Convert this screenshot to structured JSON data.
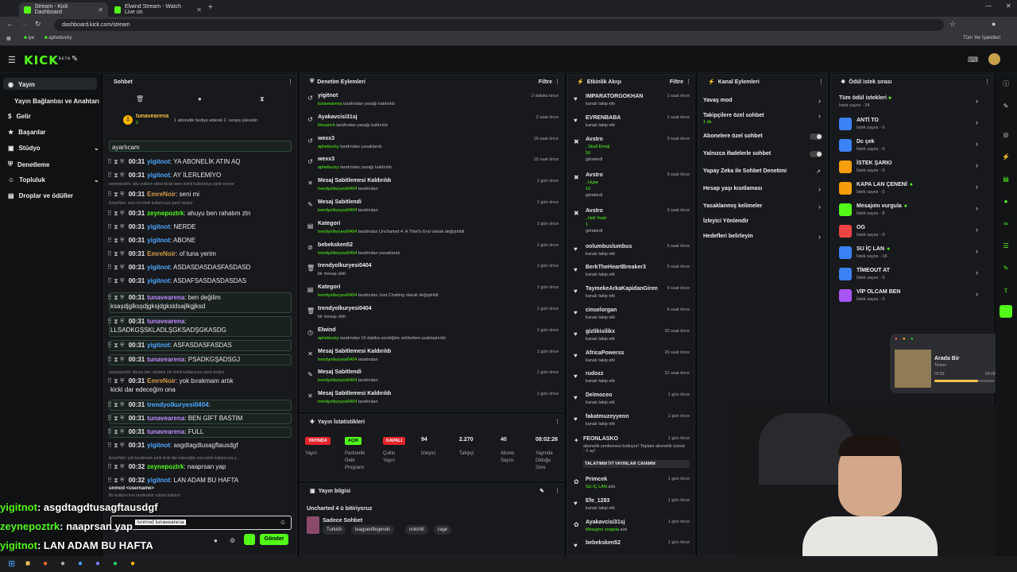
{
  "browser": {
    "tabs": [
      {
        "label": "Stream - Kick Dashboard",
        "active": true
      },
      {
        "label": "Elwind Stream - Watch Live on",
        "active": false
      }
    ],
    "url": "dashboard.kick.com/stream",
    "bookmarks": [
      "iye",
      "aphebucky"
    ],
    "all_bookmarks_label": "Tüm Yer İşaretleri"
  },
  "app": {
    "logo": "KICK",
    "logo_sup": "BETA"
  },
  "leftnav": {
    "items": [
      {
        "label": "Yayın"
      },
      {
        "label": "Yayın Bağlantısı ve Anahtarı"
      },
      {
        "label": "Gelir"
      },
      {
        "label": "Başarılar"
      },
      {
        "label": "Stüdyo"
      },
      {
        "label": "Denetleme"
      },
      {
        "label": "Topluluk"
      },
      {
        "label": "Droplar ve ödüller"
      }
    ]
  },
  "chat": {
    "title": "Sohbet",
    "pinned_user": "tunavearena",
    "pinned_count": "2",
    "pinned_text": "1 abonelik hediye ederek 2. sıraya yükselin",
    "top_fragment": "ayarlıcam",
    "messages": [
      {
        "time": "00:31",
        "user": "yigitnot",
        "color": "#4ea8ff",
        "text": ": YA ABONELİK ATIN AQ",
        "sys": ""
      },
      {
        "time": "00:31",
        "user": "yigitnot",
        "color": "#4ea8ff",
        "text": ": AY İLERLEMİYO",
        "sys": "zeynepoztrk: ahu yokken rahat birak were isimli kullaniciya yanit veriyor"
      },
      {
        "time": "00:31",
        "user": "EmreNoir",
        "color": "#d39b4a",
        "text": ": seni mi",
        "sys": "EmreNoir: seni mi isimli kullanıcıya yanıt veriyor"
      },
      {
        "time": "00:31",
        "user": "zeynepoztrk",
        "color": "#53fc18",
        "text": ": ahuyu ben rahatım ztn",
        "sys": ""
      },
      {
        "time": "00:31",
        "user": "yigitnot",
        "color": "#4ea8ff",
        "text": ": NERDE",
        "sys": ""
      },
      {
        "time": "00:31",
        "user": "yigitnot",
        "color": "#4ea8ff",
        "text": ": ABONE",
        "sys": ""
      },
      {
        "time": "00:31",
        "user": "EmreNoir",
        "color": "#d39b4a",
        "text": ": of tuna yerim",
        "sys": ""
      },
      {
        "time": "00:31",
        "user": "yigitnot",
        "color": "#4ea8ff",
        "text": ": ASDASDASDASFASDASD",
        "sys": ""
      },
      {
        "time": "00:31",
        "user": "yigitnot",
        "color": "#4ea8ff",
        "text": ": ASDAFSASDASDASDAS",
        "sys": ""
      }
    ],
    "messages2": [
      {
        "time": "00:31",
        "user": "tunavearena",
        "color": "#c28bff",
        "text": ": ben değilim",
        "line2": "ksaşdjglksşdjgksjdgksldsajlkgjksd"
      },
      {
        "time": "00:31",
        "user": "tunavearena",
        "color": "#c28bff",
        "text": ":",
        "line2": "LLSADKGŞSKLADLŞGKSADŞGKASDG"
      },
      {
        "time": "00:31",
        "user": "yigitnot",
        "color": "#4ea8ff",
        "text": ": ASFASDASFASDAS",
        "line2": ""
      },
      {
        "time": "00:31",
        "user": "tunavearena",
        "color": "#c28bff",
        "text": ": PSADKGŞADSGJ",
        "line2": ""
      }
    ],
    "sys3": "zeynepoztrk: ahuyu ben rahatım ztn isimli kullanıcıya yanıt veriyor",
    "emre_msg": {
      "time": "00:31",
      "user": "EmreNoir",
      "text": ": yok bırakmam artık",
      "line2": "kicki dar edeceğim ona"
    },
    "messages3": [
      {
        "time": "00:31",
        "user": "trendyolkuryesi0404",
        "color": "#4ea8ff",
        "text": ":"
      },
      {
        "time": "00:31",
        "user": "tunavearena",
        "color": "#c28bff",
        "text": ": BEN GİFT BASTIM"
      },
      {
        "time": "00:31",
        "user": "tunavearena",
        "color": "#c28bff",
        "text": ": FULL"
      },
      {
        "time": "00:31",
        "user": "yigitnot",
        "color": "#4ea8ff",
        "text": ": asgdtagdtusagftausdgf"
      }
    ],
    "sys4": "EmreNoir: yok bırakmam artık kicki dar edeceğim ona isimli kullanıcıya y...",
    "last_msgs": [
      {
        "time": "00:32",
        "user": "zeynepoztrk",
        "color": "#53fc18",
        "text": ": naaprsan yap"
      },
      {
        "time": "00:32",
        "user": "yigitnot",
        "color": "#4ea8ff",
        "text": ": LAN ADAM BU HAFTA"
      }
    ],
    "suggest_cmd": "unmod <username>",
    "suggest_desc": "Bir kullanıcının moderatör rolünü kaldırın",
    "input_value": "/unmod tunavearena",
    "send_label": "Gönder"
  },
  "moderation": {
    "title": "Denetim Eylemleri",
    "filter": "Filtre",
    "rows": [
      {
        "title": "yigitnot",
        "who": "tunavearena",
        "rest": " tarafından yasağı kaldırıldı",
        "time": "2 dakika önce",
        "icon": "↺"
      },
      {
        "title": "Ayakavcisi31sj",
        "who": "Revanch",
        "rest": " tarafından yasağı kaldırıldı",
        "time": "2 saat önce",
        "icon": "↺"
      },
      {
        "title": "wexx3",
        "who": "aphebucky",
        "rest": " tarafından yasaklandı",
        "time": "19 saat önce",
        "icon": "↺"
      },
      {
        "title": "wexx3",
        "who": "aphebucky",
        "rest": " tarafından yasağı kaldırıldı",
        "time": "19 saat önce",
        "icon": "↺"
      },
      {
        "title": "Mesaj Sabitlemesi Kaldırıldı",
        "who": "trendyolkuryesi0404",
        "rest": " tarafından",
        "time": "1 gün önce",
        "icon": "✕"
      },
      {
        "title": "Mesaj Sabitlendi",
        "who": "trendyolkuryesi0404",
        "rest": " tarafından",
        "time": "1 gün önce",
        "icon": "✎"
      },
      {
        "title": "Kategori",
        "who": "trendyolkuryesi0404",
        "rest": " tarafından Uncharted 4: A Thief's End olarak değiştirildi",
        "time": "1 gün önce",
        "icon": "▤"
      },
      {
        "title": "bebeksken52",
        "who": "trendyolkuryesi0404",
        "rest": " tarafından yasaklandı",
        "time": "1 gün önce",
        "icon": "⊘"
      },
      {
        "title": "trendyolkuryesi0404",
        "who": "",
        "rest": "bir mesajı sildi",
        "time": "1 gün önce",
        "icon": "🗑"
      },
      {
        "title": "Kategori",
        "who": "trendyolkuryesi0404",
        "rest": " tarafından Just Chatting olarak değiştirildi",
        "time": "1 gün önce",
        "icon": "▤"
      },
      {
        "title": "trendyolkuryesi0404",
        "who": "",
        "rest": "bir mesajı sildi",
        "time": "1 gün önce",
        "icon": "🗑"
      },
      {
        "title": "Elwind",
        "who": "aphebucky",
        "rest": " tarafından 15 dakika süreliğine sohbetten uzaklaştırıldı",
        "time": "1 gün önce",
        "icon": "◷"
      },
      {
        "title": "Mesaj Sabitlemesi Kaldırıldı",
        "who": "trendyolkuryesi0404",
        "rest": " tarafından",
        "time": "1 gün önce",
        "icon": "✕"
      },
      {
        "title": "Mesaj Sabitlendi",
        "who": "trendyolkuryesi0404",
        "rest": " tarafından",
        "time": "1 gün önce",
        "icon": "✎"
      },
      {
        "title": "Mesaj Sabitlemesi Kaldırıldı",
        "who": "trendyolkuryesi0404",
        "rest": " tarafından",
        "time": "1 gün önce",
        "icon": "✕"
      }
    ]
  },
  "stats": {
    "title": "Yayın İstatistikleri",
    "items": [
      {
        "value": "YAYINDA",
        "label": "Yayın",
        "kind": "red"
      },
      {
        "value": "AÇIK",
        "label": "Partnerlik\nGelir\nProgramı",
        "kind": "green"
      },
      {
        "value": "KAPALI",
        "label": "Çoklu\nYayın",
        "kind": "red"
      },
      {
        "value": "94",
        "label": "İzleyici",
        "kind": "num"
      },
      {
        "value": "2.270",
        "label": "Takipçi",
        "kind": "num"
      },
      {
        "value": "40",
        "label": "Abone\nSayısı",
        "kind": "num"
      },
      {
        "value": "08:02:26",
        "label": "Yayında\nOlduğu\nSüre",
        "kind": "num"
      }
    ]
  },
  "streaminfo": {
    "title": "Yayın bilgisi",
    "stream_title": "Uncharted 4 ü bitiriyoruz",
    "category": "Sadece Sohbet",
    "tags": [
      "Turkish",
      "leagueoflegends",
      "notchill",
      "rage"
    ]
  },
  "activity": {
    "title": "Etkinlik Akışı",
    "filter": "Filtre",
    "items": [
      {
        "user": "IMPARATORGOKHAN",
        "sub": "kanalı takip etti",
        "time": "1 saat önce",
        "icon": "♥"
      },
      {
        "user": "EVRENBABA",
        "sub": "kanalı takip etti",
        "time": "2 saat önce",
        "icon": "♥"
      },
      {
        "user": "Avstro",
        "sub": ", Skull Emoji",
        "sub2": "50",
        "sub3": "gönderdi",
        "time": "3 saat önce",
        "icon": "✖"
      },
      {
        "user": "Avstro",
        "sub": ", Hype",
        "sub2": "10",
        "sub3": "gönderdi",
        "time": "3 saat önce",
        "icon": "✖"
      },
      {
        "user": "Avstro",
        "sub": ", Hell Yeah",
        "sub2": "1",
        "sub3": "gönderdi",
        "time": "3 saat önce",
        "icon": "✖"
      },
      {
        "user": "oolumbuslumbus",
        "sub": "kanalı takip etti",
        "time": "5 saat önce",
        "icon": "♥"
      },
      {
        "user": "BerkTheHeartBreaker3",
        "sub": "kanalı takip etti",
        "time": "5 saat önce",
        "icon": "♥"
      },
      {
        "user": "TaymekeArkaKapidanGiren",
        "sub": "kanalı takip etti",
        "time": "6 saat önce",
        "icon": "♥"
      },
      {
        "user": "cinselorgan",
        "sub": "kanalı takip etti",
        "time": "6 saat önce",
        "icon": "♥"
      },
      {
        "user": "gizlikisilikx",
        "sub": "kanalı takip etti",
        "time": "20 saat önce",
        "icon": "♥"
      },
      {
        "user": "AfricaPowerss",
        "sub": "kanalı takip etti",
        "time": "20 saat önce",
        "icon": "♥"
      },
      {
        "user": "rudozz",
        "sub": "kanalı takip etti",
        "time": "22 saat önce",
        "icon": "♥"
      },
      {
        "user": "Delmoceo",
        "sub": "kanalı takip etti",
        "time": "1 gün önce",
        "icon": "♥"
      },
      {
        "user": "fakatmuzeyyenn",
        "sub": "kanalı takip etti",
        "time": "1 gün önce",
        "icon": "♥"
      }
    ],
    "feonlasko": {
      "user": "FEONLASKO",
      "time": "1 gün önce",
      "line": "abonelik yenilemesi kutluyor! Toplam abonelik süresi - 2 ay!",
      "msg": "TALATIMM İYİ YAYINLAR CANIMM"
    },
    "redeems": [
      {
        "user": "Primcek",
        "reward": "SU İÇ LAN",
        "rest": " aldı",
        "time": "1 gün önce",
        "icon": "✿"
      },
      {
        "user": "Efe_1283",
        "sub": "kanalı takip etti",
        "time": "1 gün önce",
        "icon": "♥"
      },
      {
        "user": "Ayakavcisi31sj",
        "reward": "Mesajımı vurgula",
        "rest": " aldı",
        "time": "1 gün önce",
        "icon": "✿"
      },
      {
        "user": "bebeksken52",
        "sub": "",
        "time": "1 gün önce",
        "icon": "♥"
      }
    ]
  },
  "channel_actions": {
    "title": "Kanal Eylemleri",
    "items": [
      {
        "label": "Yavaş mod",
        "sub": "",
        "kind": "chev"
      },
      {
        "label": "Takipçilere özel sohbet",
        "sub": "1 dk.",
        "kind": "chev"
      },
      {
        "label": "Abonelere özel sohbet",
        "sub": "",
        "kind": "toggle"
      },
      {
        "label": "Yalnızca ifadelerle sohbet",
        "sub": "",
        "kind": "toggle"
      },
      {
        "label": "Yapay Zeka ile Sohbet Denetimi",
        "sub": "",
        "kind": "ext"
      },
      {
        "label": "Hesap yaşı kısıtlaması",
        "sub": "",
        "kind": "chev"
      },
      {
        "label": "Yasaklanmış kelimeler",
        "sub": "",
        "kind": "chev"
      },
      {
        "label": "İzleyici Yönlendir",
        "sub": "",
        "kind": "none"
      },
      {
        "label": "Hedefleri belirleyin",
        "sub": "",
        "kind": "chev"
      }
    ]
  },
  "rewards": {
    "title": "Ödül istek sırası",
    "all": {
      "label": "Tüm ödül istekleri",
      "sub": "İstek sayısı - 34"
    },
    "items": [
      {
        "label": "ANTİ TO",
        "sub": "İstek sayısı - 0",
        "color": "#3b82f6",
        "dot": false
      },
      {
        "label": "Dc çek",
        "sub": "İstek sayısı - 0",
        "color": "#3b82f6",
        "dot": false
      },
      {
        "label": "İSTEK ŞARKI",
        "sub": "İstek sayısı - 0",
        "color": "#f59e0b",
        "dot": false
      },
      {
        "label": "KAPA LAN ÇENENİ",
        "sub": "İstek sayısı - 0",
        "color": "#f59e0b",
        "dot": true
      },
      {
        "label": "Mesajımı vurgula",
        "sub": "İstek sayısı - 8",
        "color": "#53fc18",
        "dot": true
      },
      {
        "label": "OG",
        "sub": "İstek sayısı - 0",
        "color": "#ef4444",
        "dot": false
      },
      {
        "label": "SU İÇ LAN",
        "sub": "İstek sayısı - 16",
        "color": "#3b82f6",
        "dot": true
      },
      {
        "label": "TİMEOUT AT",
        "sub": "İstek sayısı - 0",
        "color": "#3b82f6",
        "dot": false
      },
      {
        "label": "VİP OLCAM BEN",
        "sub": "İstek sayısı - 0",
        "color": "#a855f7",
        "dot": false
      }
    ]
  },
  "player": {
    "title": "Arada Bir",
    "artist": "Torkon",
    "elapsed": "02:59",
    "total": "04:09",
    "progress": 0.72
  },
  "overlay": [
    {
      "user": "yigitnot",
      "text": ": asgdtagdtusagftausdgf"
    },
    {
      "user": "zeynepoztrk",
      "text": ": naaprsan yap"
    },
    {
      "user": "yigitnot",
      "text": ": LAN ADAM BU HAFTA"
    }
  ]
}
